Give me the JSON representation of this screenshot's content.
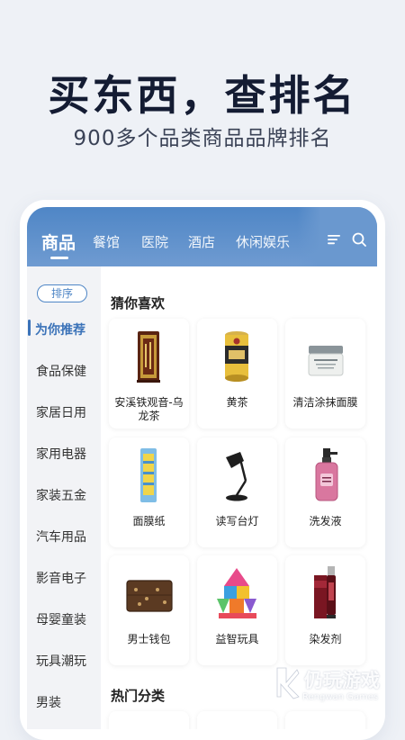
{
  "hero": {
    "title": "买东西，查排名",
    "subtitle": "900多个品类商品品牌排名"
  },
  "tabs": [
    {
      "label": "商品",
      "active": true
    },
    {
      "label": "餐馆"
    },
    {
      "label": "医院"
    },
    {
      "label": "酒店"
    },
    {
      "label": "休闲娱乐"
    }
  ],
  "header_icons": [
    "list-menu-icon",
    "search-icon"
  ],
  "sidebar": {
    "sort_label": "排序",
    "items": [
      "为你推荐",
      "食品保健",
      "家居日用",
      "家用电器",
      "家装五金",
      "汽车用品",
      "影音电子",
      "母婴童装",
      "玩具潮玩",
      "男装"
    ],
    "active_index": 0
  },
  "sections": {
    "guess_title": "猜你喜欢",
    "hot_title": "热门分类"
  },
  "products": [
    {
      "label": "安溪铁观音-乌龙茶",
      "icon": "tea-box-icon"
    },
    {
      "label": "黄茶",
      "icon": "tea-can-icon"
    },
    {
      "label": "清洁涂抹面膜",
      "icon": "cream-jar-icon"
    },
    {
      "label": "面膜纸",
      "icon": "mask-paper-icon"
    },
    {
      "label": "读写台灯",
      "icon": "desk-lamp-icon"
    },
    {
      "label": "洗发液",
      "icon": "shampoo-bottle-icon"
    },
    {
      "label": "男士钱包",
      "icon": "wallet-icon"
    },
    {
      "label": "益智玩具",
      "icon": "magnetic-blocks-icon"
    },
    {
      "label": "染发剂",
      "icon": "hair-dye-icon"
    }
  ],
  "watermark": {
    "text": "仍玩游戏",
    "sub": "Rengwan Games"
  },
  "colors": {
    "accent": "#4f86c6",
    "background": "#eef1f6",
    "title": "#141c33"
  }
}
